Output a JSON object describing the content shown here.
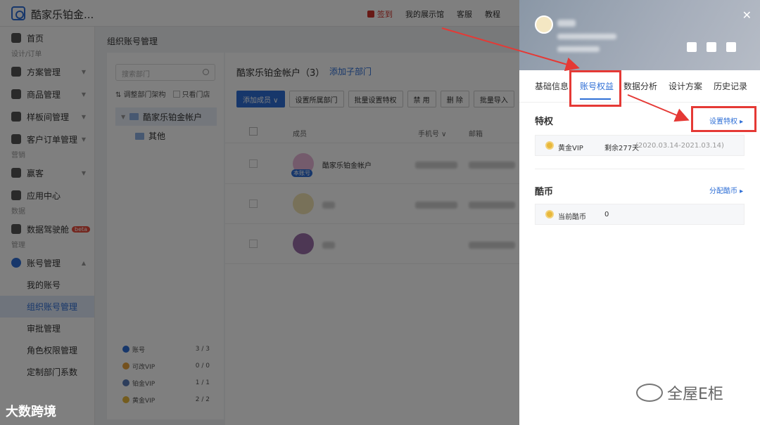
{
  "topbar": {
    "brand": "酷家乐铂金...",
    "sign_label": "签到",
    "links": [
      "我的展示馆",
      "客服",
      "教程"
    ]
  },
  "sidebar": {
    "home": "首页",
    "sec_design": "设计/订单",
    "items_design": [
      "方案管理",
      "商品管理",
      "样板间管理",
      "客户订单管理"
    ],
    "sec_marketing": "营销",
    "items_marketing": [
      "赢客",
      "应用中心"
    ],
    "sec_data": "数据",
    "data_cockpit": "数据驾驶舱",
    "beta": "beta",
    "sec_manage": "管理",
    "account_mgmt": "账号管理",
    "subs": [
      "我的账号",
      "组织账号管理",
      "审批管理",
      "角色权限管理",
      "定制部门系数"
    ]
  },
  "main": {
    "title": "组织账号管理",
    "search_placeholder": "搜索部门",
    "opt_adjust": "调整部门架构",
    "opt_only_store": "只看门店",
    "tree_root": "酷家乐铂金帐户",
    "tree_child": "其他",
    "stats": [
      {
        "label": "账号",
        "value": "3 / 3",
        "color": "#2f6fd6"
      },
      {
        "label": "可改VIP",
        "value": "0 / 0",
        "color": "#e8a33c"
      },
      {
        "label": "铂金VIP",
        "value": "1 / 1",
        "color": "#5b7db8"
      },
      {
        "label": "黄金VIP",
        "value": "2 / 2",
        "color": "#e8b83c"
      }
    ],
    "org_head": "酷家乐铂金帐户（3）",
    "add_sub_dept": "添加子部门",
    "toolbar": [
      "添加成员 ∨",
      "设置所属部门",
      "批量设置特权",
      "禁 用",
      "删 除",
      "批量导入"
    ],
    "columns": {
      "member": "成员",
      "phone": "手机号 ∨",
      "email": "邮箱"
    },
    "row1_name": "酷家乐铂金帐户",
    "row1_tag": "本账号"
  },
  "drawer": {
    "tabs": [
      "基础信息",
      "账号权益",
      "数据分析",
      "设计方案",
      "历史记录"
    ],
    "privilege_title": "特权",
    "set_privilege": "设置特权 ▸",
    "vip_name": "黄金VIP",
    "vip_remaining": "剩余277天",
    "vip_range": "(2020.03.14-2021.03.14)",
    "coin_title": "酷币",
    "allocate_coin": "分配酷币 ▸",
    "current_coin_label": "当前酷币",
    "current_coin_value": "0"
  },
  "watermark": {
    "left": "大数跨境",
    "right": "全屋E柜"
  },
  "colors": {
    "accent": "#2f6fd6",
    "highlight": "#e53935"
  }
}
